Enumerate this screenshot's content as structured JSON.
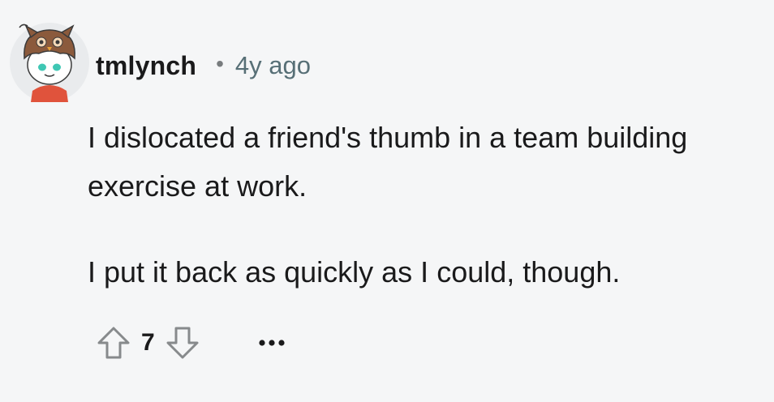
{
  "comment": {
    "username": "tmlynch",
    "separator": "•",
    "timestamp": "4y ago",
    "paragraphs": [
      "I dislocated a friend's thumb in a team building exercise at work.",
      "I put it back as quickly as I could, though."
    ],
    "score": "7",
    "more_label": "•••"
  },
  "icons": {
    "avatar": "owl-snoo-avatar",
    "upvote": "upvote-arrow-icon",
    "downvote": "downvote-arrow-icon",
    "more": "more-options-icon"
  },
  "colors": {
    "background": "#f5f6f7",
    "text": "#1a1a1b",
    "meta": "#576f76",
    "icon": "#878a8c"
  }
}
